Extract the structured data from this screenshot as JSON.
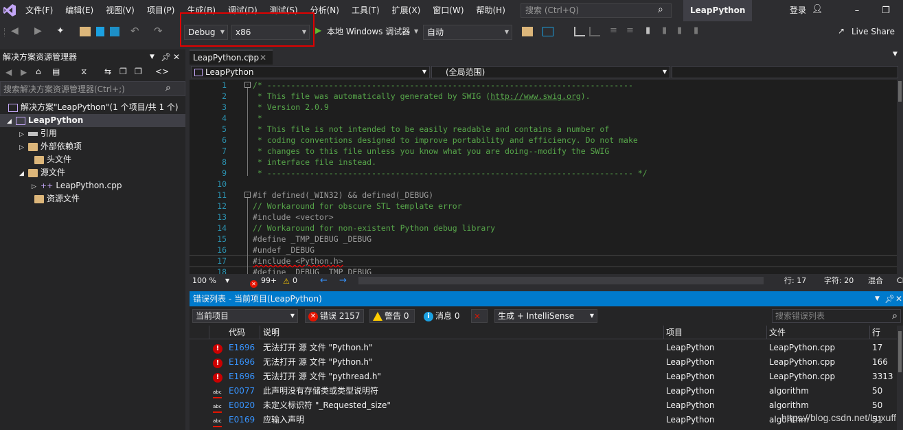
{
  "menu": [
    "文件(F)",
    "编辑(E)",
    "视图(V)",
    "项目(P)",
    "生成(B)",
    "调试(D)",
    "测试(S)",
    "分析(N)",
    "工具(T)",
    "扩展(X)",
    "窗口(W)",
    "帮助(H)"
  ],
  "search": {
    "placeholder": "搜索 (Ctrl+Q)"
  },
  "app_title": "LeapPython",
  "login": "登录",
  "toolbar": {
    "config": "Debug",
    "platform": "x86",
    "debugger": "本地 Windows 调试器",
    "auto": "自动",
    "live_share": "Live Share"
  },
  "solution_explorer": {
    "title": "解决方案资源管理器",
    "search_placeholder": "搜索解决方案资源管理器(Ctrl+;)",
    "items": [
      {
        "label": "解决方案\"LeapPython\"(1 个项目/共 1 个)"
      },
      {
        "label": "LeapPython"
      },
      {
        "label": "引用"
      },
      {
        "label": "外部依赖项"
      },
      {
        "label": "头文件"
      },
      {
        "label": "源文件"
      },
      {
        "label": "LeapPython.cpp"
      },
      {
        "label": "资源文件"
      }
    ]
  },
  "editor": {
    "tab": "LeapPython.cpp",
    "nav_project": "LeapPython",
    "nav_scope": "(全局范围)",
    "lines": [
      {
        "n": "1",
        "t": "/* -----------------------------------------------------------------------------"
      },
      {
        "n": "2",
        "t": " * This file was automatically generated by SWIG (",
        "u": "http://www.swig.org",
        "t2": ")."
      },
      {
        "n": "3",
        "t": " * Version 2.0.9"
      },
      {
        "n": "4",
        "t": " *"
      },
      {
        "n": "5",
        "t": " * This file is not intended to be easily readable and contains a number of"
      },
      {
        "n": "6",
        "t": " * coding conventions designed to improve portability and efficiency. Do not make"
      },
      {
        "n": "7",
        "t": " * changes to this file unless you know what you are doing--modify the SWIG"
      },
      {
        "n": "8",
        "t": " * interface file instead."
      },
      {
        "n": "9",
        "t": " * ----------------------------------------------------------------------------- */"
      },
      {
        "n": "10",
        "t": ""
      },
      {
        "n": "11",
        "t": "#if defined(_WIN32) && defined(_DEBUG)"
      },
      {
        "n": "12",
        "t": "// Workaround for obscure STL template error"
      },
      {
        "n": "13",
        "t": "#include <vector>"
      },
      {
        "n": "14",
        "t": "// Workaround for non-existent Python debug library"
      },
      {
        "n": "15",
        "t": "#define _TMP_DEBUG _DEBUG"
      },
      {
        "n": "16",
        "t": "#undef _DEBUG"
      },
      {
        "n": "17",
        "t": "#include <Python.h>"
      },
      {
        "n": "18",
        "t": "#define _DEBUG _TMP_DEBUG"
      }
    ],
    "status": {
      "zoom": "100 %",
      "errors": "99+",
      "warnings": "0",
      "line": "行: 17",
      "char": "字符: 20",
      "mode": "混合",
      "eol": "CRLF"
    }
  },
  "error_list": {
    "title": "错误列表 - 当前项目(LeapPython)",
    "scope": "当前项目",
    "errors_btn": "错误 2157",
    "warnings_btn": "警告 0",
    "messages_btn": "消息 0",
    "build_filter": "生成 + IntelliSense",
    "search_placeholder": "搜索错误列表",
    "columns": [
      "代码",
      "说明",
      "项目",
      "文件",
      "行"
    ],
    "rows": [
      {
        "kind": "error",
        "code": "E1696",
        "desc": "无法打开 源 文件 \"Python.h\"",
        "project": "LeapPython",
        "file": "LeapPython.cpp",
        "line": "17"
      },
      {
        "kind": "error",
        "code": "E1696",
        "desc": "无法打开 源 文件 \"Python.h\"",
        "project": "LeapPython",
        "file": "LeapPython.cpp",
        "line": "166"
      },
      {
        "kind": "error",
        "code": "E1696",
        "desc": "无法打开 源 文件 \"pythread.h\"",
        "project": "LeapPython",
        "file": "LeapPython.cpp",
        "line": "3313"
      },
      {
        "kind": "abc",
        "code": "E0077",
        "desc": "此声明没有存储类或类型说明符",
        "project": "LeapPython",
        "file": "algorithm",
        "line": "50"
      },
      {
        "kind": "abc",
        "code": "E0020",
        "desc": "未定义标识符 \"_Requested_size\"",
        "project": "LeapPython",
        "file": "algorithm",
        "line": "50"
      },
      {
        "kind": "abc",
        "code": "E0169",
        "desc": "应输入声明",
        "project": "LeapPython",
        "file": "algorithm",
        "line": "51"
      }
    ]
  },
  "watermark": "https://blog.csdn.net/Luxuff",
  "colors": {
    "accent": "#007acc",
    "highlight": "#e00000",
    "comment": "#57a64a"
  }
}
